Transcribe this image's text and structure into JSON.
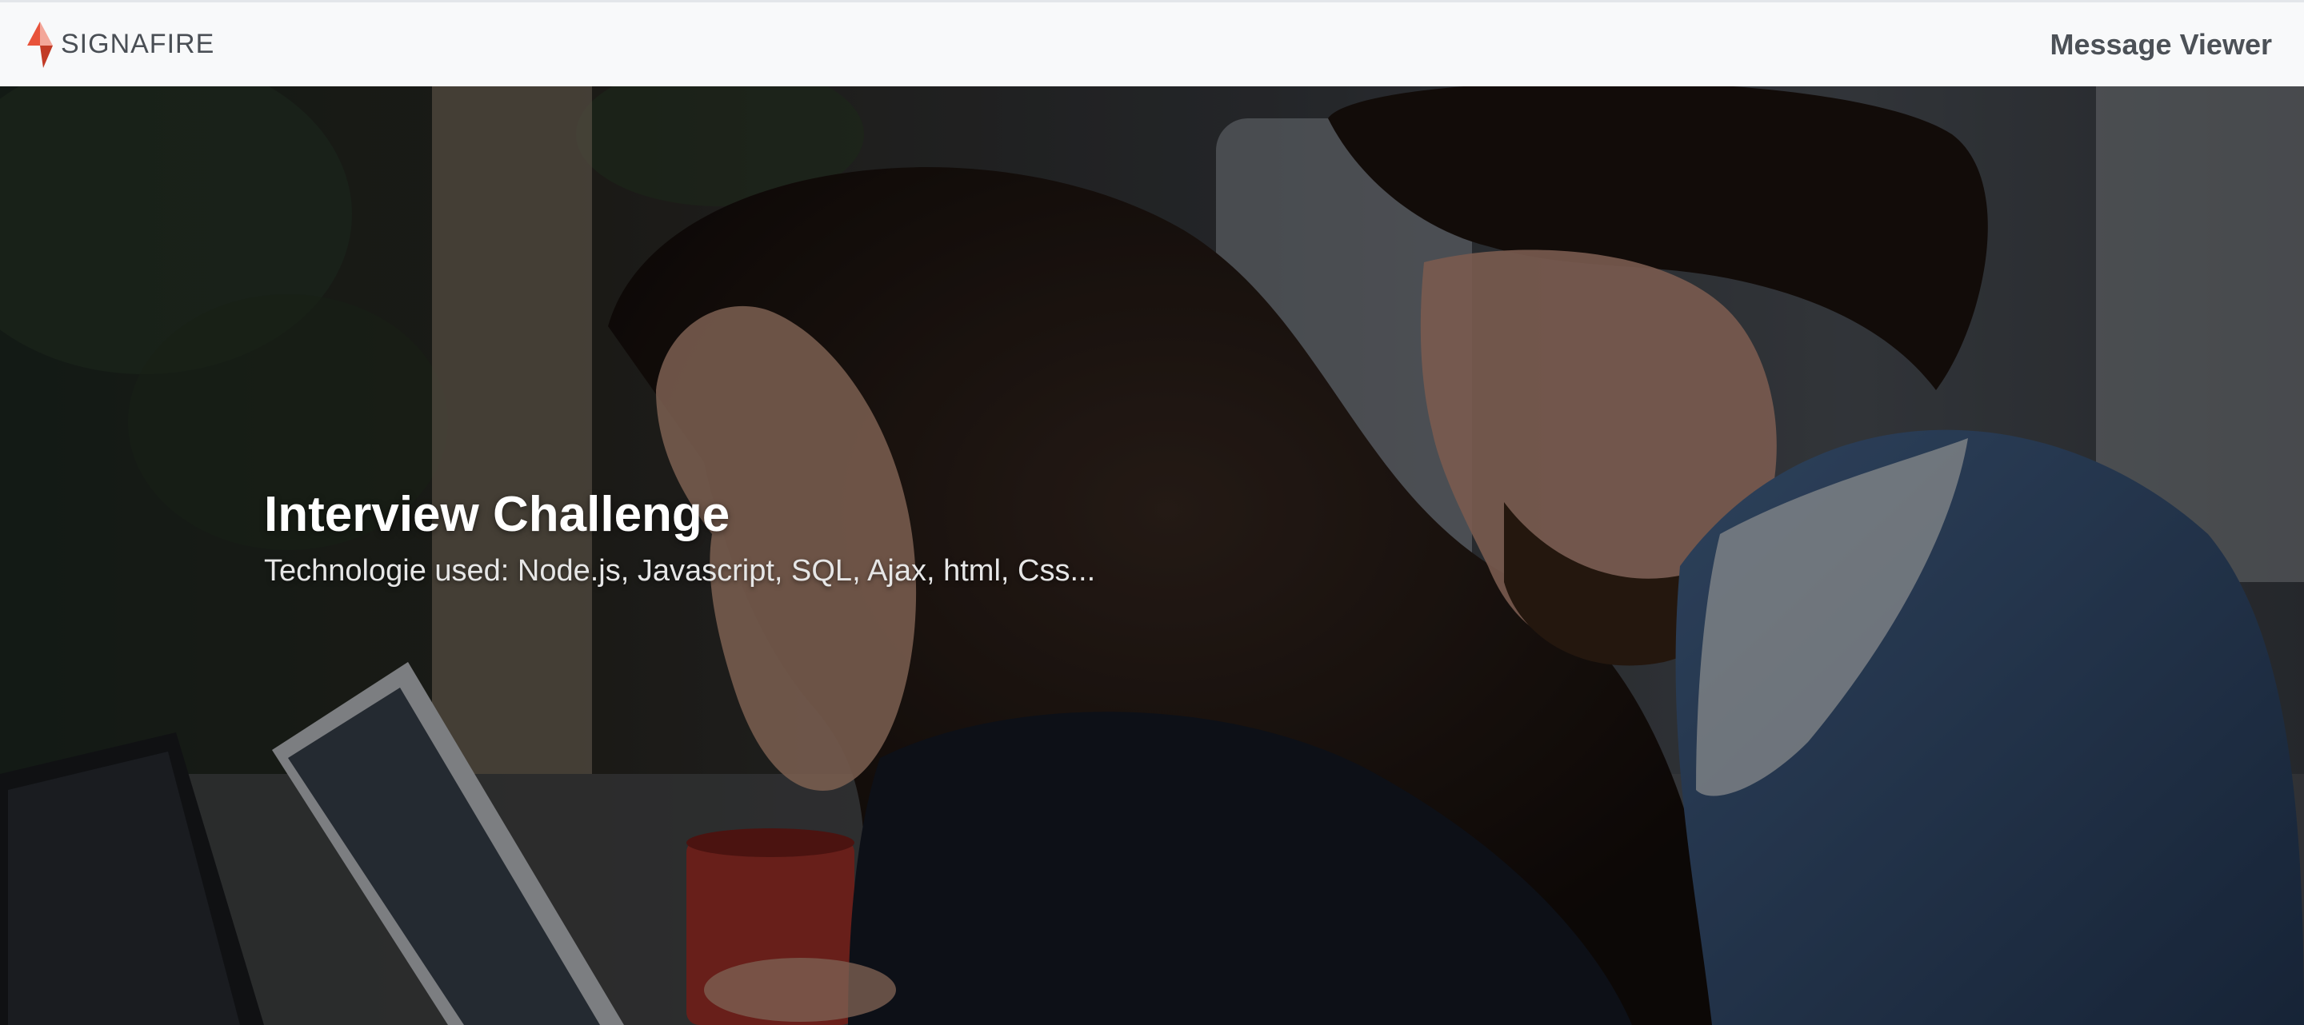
{
  "navbar": {
    "brand_name": "SIGNAFIRE",
    "brand_icon": "flame-logo-icon",
    "nav_link": "Message Viewer"
  },
  "hero": {
    "title": "Interview Challenge",
    "subtitle": "Technologie used: Node.js, Javascript, SQL, Ajax, html, Css..."
  },
  "colors": {
    "navbar_bg": "#f8f9fa",
    "logo_orange": "#e8533a",
    "logo_dark_orange": "#c23b26",
    "nav_text": "#4c5157",
    "hero_title": "#ffffff"
  }
}
